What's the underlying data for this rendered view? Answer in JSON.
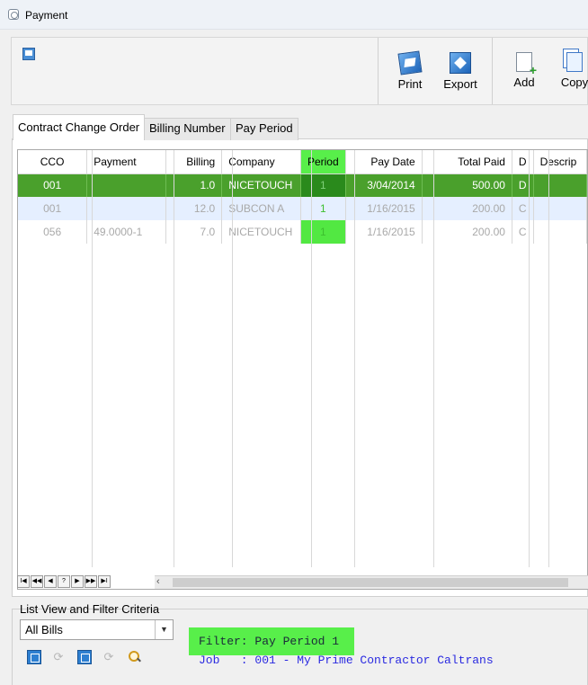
{
  "window": {
    "title": "Payment"
  },
  "toolbar": {
    "buttons": [
      {
        "label": "Print",
        "icon": "print-icon"
      },
      {
        "label": "Export",
        "icon": "export-icon"
      },
      {
        "label": "Add",
        "icon": "add-icon"
      },
      {
        "label": "Copy",
        "icon": "copy-icon"
      }
    ]
  },
  "tabs": [
    {
      "label": "Contract Change Order",
      "active": true
    },
    {
      "label": "Billing Number",
      "active": false
    },
    {
      "label": "Pay Period",
      "active": false
    }
  ],
  "grid": {
    "columns": [
      "CCO",
      "Payment",
      "Billing",
      "Company",
      "Period",
      "Pay Date",
      "Total Paid",
      "D",
      "Descrip"
    ],
    "rows": [
      [
        "001",
        "",
        "1.0",
        "NICETOUCH",
        "1",
        "3/04/2014",
        "500.00",
        "D",
        ""
      ],
      [
        "001",
        "",
        "12.0",
        "SUBCON A",
        "1",
        "1/16/2015",
        "200.00",
        "C",
        ""
      ],
      [
        "056",
        "49.0000-1",
        "7.0",
        "NICETOUCH",
        "1",
        "1/16/2015",
        "200.00",
        "C",
        ""
      ]
    ],
    "highlight_color": "#58ef4a",
    "selected_row_color": "#4aa02c"
  },
  "pager": [
    "I◀",
    "◀◀",
    "◀",
    "?",
    "▶",
    "▶▶",
    "▶I"
  ],
  "filter": {
    "section_label": "List View and Filter Criteria",
    "select_value": "All Bills",
    "filter_text": "Filter: Pay Period 1",
    "job_text": "Job   : 001 - My Prime Contractor Caltrans"
  }
}
